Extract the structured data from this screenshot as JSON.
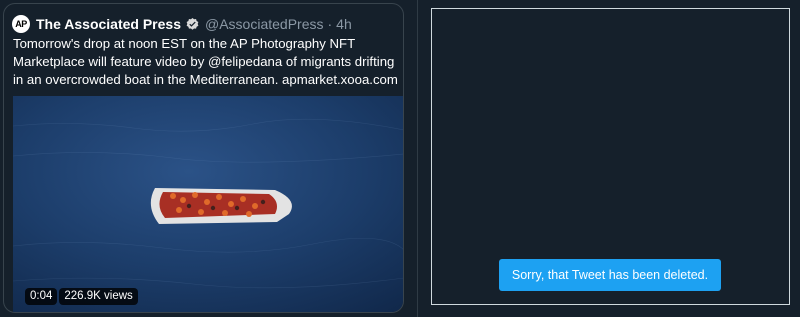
{
  "tweet": {
    "author_logo_text": "AP",
    "author_name": "The Associated Press",
    "handle": "@AssociatedPress",
    "separator": "·",
    "time": "4h",
    "text": "Tomorrow's drop at noon EST on the AP Photography NFT Marketplace will feature video by @felipedana of migrants drifting in an overcrowded boat in the Mediterranean. apmarket.xooa.com",
    "media": {
      "duration": "0:04",
      "views": "226.9K views"
    }
  },
  "deleted_tweet": {
    "message": "Sorry, that Tweet has been deleted."
  },
  "colors": {
    "background": "#15202b",
    "accent": "#1da1f2",
    "sea": "#1f3f6b",
    "muted_text": "#8b98a5"
  },
  "icons": [
    "ap-logo-icon",
    "verified-badge-icon"
  ]
}
